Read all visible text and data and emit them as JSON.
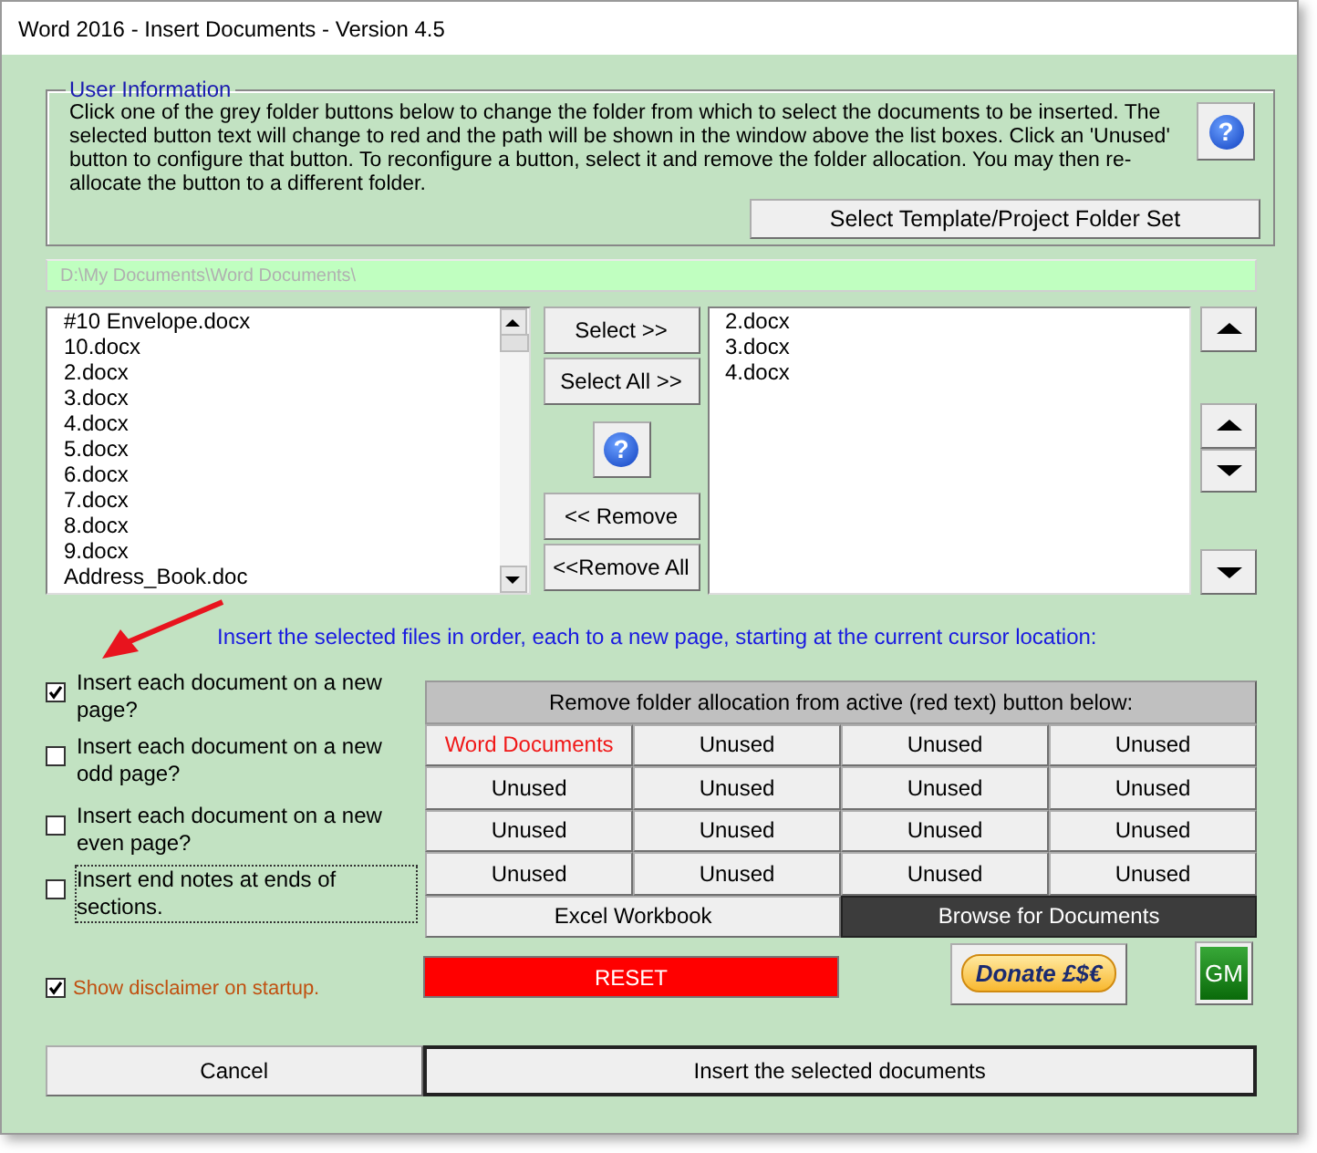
{
  "window": {
    "title": "Word 2016 - Insert Documents - Version 4.5"
  },
  "user_information": {
    "legend": "User Information",
    "text": "Click one of the grey folder buttons below to change the folder from which to select the documents to be inserted. The selected button text will change to red and the path will be shown in the window above the list boxes. Click an 'Unused' button to configure that button. To reconfigure a button, select it and remove the folder allocation. You may then re-allocate the button to a different folder.",
    "help_glyph": "?",
    "template_button": "Select Template/Project Folder Set"
  },
  "path_field": {
    "value": "D:\\My Documents\\Word Documents\\"
  },
  "source_list": {
    "items": [
      "#10 Envelope.docx",
      "10.docx",
      "2.docx",
      "3.docx",
      "4.docx",
      "5.docx",
      "6.docx",
      "7.docx",
      "8.docx",
      "9.docx",
      "Address_Book.doc"
    ]
  },
  "transfer_buttons": [
    "Select >>",
    "Select All >>",
    "<< Remove",
    "<<Remove All"
  ],
  "transfer_help_glyph": "?",
  "selected_list": {
    "items": [
      "2.docx",
      "3.docx",
      "4.docx"
    ]
  },
  "instruction": "Insert the selected files in order, each to a new page, starting at the current cursor location:",
  "options": [
    {
      "label": "Insert each document on a new page?",
      "checked": true,
      "focused": false
    },
    {
      "label": "Insert each document on a new odd page?",
      "checked": false,
      "focused": false
    },
    {
      "label": "Insert each document on a new even page?",
      "checked": false,
      "focused": false
    },
    {
      "label": "Insert end notes at ends of sections.",
      "checked": false,
      "focused": true
    }
  ],
  "folder_panel": {
    "header": "Remove folder allocation from active (red text) button below:",
    "buttons": [
      {
        "label": "Word Documents",
        "selected": true
      },
      {
        "label": "Unused",
        "selected": false
      },
      {
        "label": "Unused",
        "selected": false
      },
      {
        "label": "Unused",
        "selected": false
      },
      {
        "label": "Unused",
        "selected": false
      },
      {
        "label": "Unused",
        "selected": false
      },
      {
        "label": "Unused",
        "selected": false
      },
      {
        "label": "Unused",
        "selected": false
      },
      {
        "label": "Unused",
        "selected": false
      },
      {
        "label": "Unused",
        "selected": false
      },
      {
        "label": "Unused",
        "selected": false
      },
      {
        "label": "Unused",
        "selected": false
      },
      {
        "label": "Unused",
        "selected": false
      },
      {
        "label": "Unused",
        "selected": false
      },
      {
        "label": "Unused",
        "selected": false
      },
      {
        "label": "Unused",
        "selected": false
      }
    ],
    "footer_buttons": [
      {
        "label": "Excel Workbook",
        "selected": false
      },
      {
        "label": "Browse for Documents",
        "selected": true
      }
    ]
  },
  "disclaimer": {
    "label": "Show disclaimer on startup.",
    "checked": true
  },
  "reset_button": "RESET",
  "donate_button": "Donate £$€",
  "gm_button": "GM",
  "cancel_button": "Cancel",
  "insert_button": "Insert the selected documents"
}
